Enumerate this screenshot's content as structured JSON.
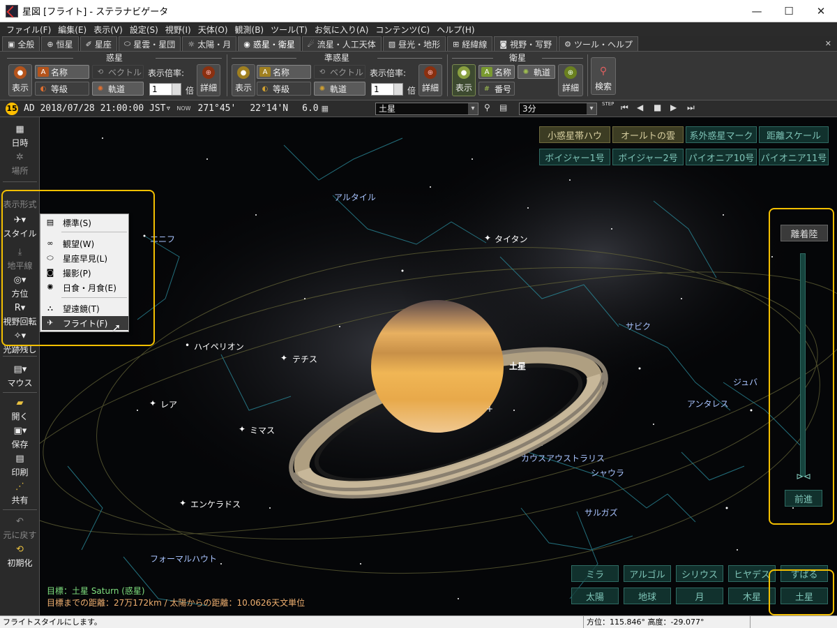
{
  "window": {
    "title": "星図 [フライト] - ステラナビゲータ",
    "minimize": "—",
    "maximize": "☐",
    "close": "✕"
  },
  "menu": [
    "ファイル(F)",
    "編集(E)",
    "表示(V)",
    "設定(S)",
    "視野(I)",
    "天体(O)",
    "観測(B)",
    "ツール(T)",
    "お気に入り(A)",
    "コンテンツ(C)",
    "ヘルプ(H)"
  ],
  "tabs": [
    {
      "icon": "▣",
      "label": "全般"
    },
    {
      "icon": "⊕",
      "label": "恒星"
    },
    {
      "icon": "✐",
      "label": "星座"
    },
    {
      "icon": "⬭",
      "label": "星雲・星団"
    },
    {
      "icon": "☼",
      "label": "太陽・月"
    },
    {
      "icon": "◉",
      "label": "惑星・衛星",
      "active": true
    },
    {
      "icon": "☄",
      "label": "流星・人工天体"
    },
    {
      "icon": "▨",
      "label": "昼光・地形"
    },
    {
      "icon": "⊞",
      "label": "経緯線"
    },
    {
      "icon": "◙",
      "label": "視野・写野"
    },
    {
      "icon": "⚙",
      "label": "ツール・ヘルプ"
    }
  ],
  "tab_close": "✕",
  "ribbon": {
    "planet": {
      "title": "惑星",
      "show": "表示",
      "name": "名称",
      "vector": "ベクトル",
      "magnitude": "等級",
      "orbit": "軌道",
      "scale_label": "表示倍率:",
      "scale_value": "1",
      "unit": "倍",
      "detail": "詳細"
    },
    "dwarf": {
      "title": "準惑星",
      "show": "表示",
      "name": "名称",
      "vector": "ベクトル",
      "magnitude": "等級",
      "orbit": "軌道",
      "scale_label": "表示倍率:",
      "scale_value": "1",
      "unit": "倍",
      "detail": "詳細"
    },
    "satellite": {
      "title": "衛星",
      "show": "表示",
      "name": "名称",
      "orbit": "軌道",
      "number": "番号",
      "detail": "詳細"
    },
    "search": "検索"
  },
  "status": {
    "badge": "15",
    "datetime": "AD 2018/07/28 21:00:00 JST▿",
    "now": "NOW",
    "lon": "271°45'",
    "lat": "22°14'N",
    "mag": "6.0",
    "target": "土星",
    "step": "3分",
    "step_label": "STEP"
  },
  "leftbar": [
    {
      "icon": "▦",
      "label": "日時",
      "dim": false
    },
    {
      "icon": "✲",
      "label": "場所",
      "dim": true
    },
    {
      "icon": "",
      "label": "表示形式",
      "dim": true
    },
    {
      "icon": "✈▾",
      "label": "スタイル",
      "dim": false
    },
    {
      "icon": "⤓",
      "label": "地平線",
      "dim": true
    },
    {
      "icon": "◎▾",
      "label": "方位",
      "dim": false
    },
    {
      "icon": "R▾",
      "label": "視野回転",
      "dim": false
    },
    {
      "icon": "✧▾",
      "label": "光跡残し",
      "dim": false
    },
    {
      "icon": "▤▾",
      "label": "マウス",
      "dim": false
    },
    {
      "icon": "📂",
      "label": "開く",
      "dim": false
    },
    {
      "icon": "▾",
      "label": "保存",
      "dim": false
    },
    {
      "icon": "▤",
      "label": "印刷",
      "dim": false
    },
    {
      "icon": "⋰",
      "label": "共有",
      "dim": false
    },
    {
      "icon": "↶",
      "label": "元に戻す",
      "dim": true
    },
    {
      "icon": "⟲",
      "label": "初期化",
      "dim": false
    }
  ],
  "style_menu": [
    {
      "icon": "▤",
      "label": "標準(S)"
    },
    {
      "icon": "∞",
      "label": "観望(W)"
    },
    {
      "icon": "⬭",
      "label": "星座早見(L)"
    },
    {
      "icon": "◙",
      "label": "撮影(P)"
    },
    {
      "icon": "✺",
      "label": "日食・月食(E)"
    },
    {
      "icon": "⛬",
      "label": "望遠鏡(T)"
    },
    {
      "icon": "✈",
      "label": "フライト(F)",
      "selected": true
    }
  ],
  "overlay_buttons_top": [
    "小惑星帯ハウ",
    "オールトの雲",
    "系外惑星マーク",
    "距離スケール",
    "ボイジャー1号",
    "ボイジャー2号",
    "パイオニア10号",
    "パイオニア11号"
  ],
  "flight_panel": {
    "top": "離着陸",
    "bottom": "前進"
  },
  "quick_targets": [
    "ミラ",
    "アルゴル",
    "シリウス",
    "ヒヤデス",
    "すばる",
    "太陽",
    "地球",
    "月",
    "木星",
    "土星"
  ],
  "sky_labels": {
    "moons": [
      "タイタン",
      "ハイペリオン",
      "テチス",
      "レア",
      "ミマス",
      "エンケラドス"
    ],
    "planet": "土星",
    "stars": [
      "アルタイル",
      "エニフ",
      "サビク",
      "ジュバ",
      "アンタレス",
      "シャウラ",
      "サルガズ",
      "フォーマルハウト"
    ],
    "constellations": [
      "カウスアウストラリス"
    ]
  },
  "info": {
    "target_line": "目標：土星 Saturn (惑星)",
    "distance_line": "目標までの距離：27万172km / 太陽からの距離：10.0626天文単位"
  },
  "statusbar": {
    "message": "フライトスタイルにします。",
    "position": "方位：115.846°  高度：-29.077°"
  },
  "colors": {
    "accent": "#f4c000",
    "saturn_body": "#e8a94a",
    "ring": "#c8b89a",
    "green_text": "#7fe07f",
    "orange_text": "#f0b070",
    "const_lines": "#2a8a9a"
  }
}
